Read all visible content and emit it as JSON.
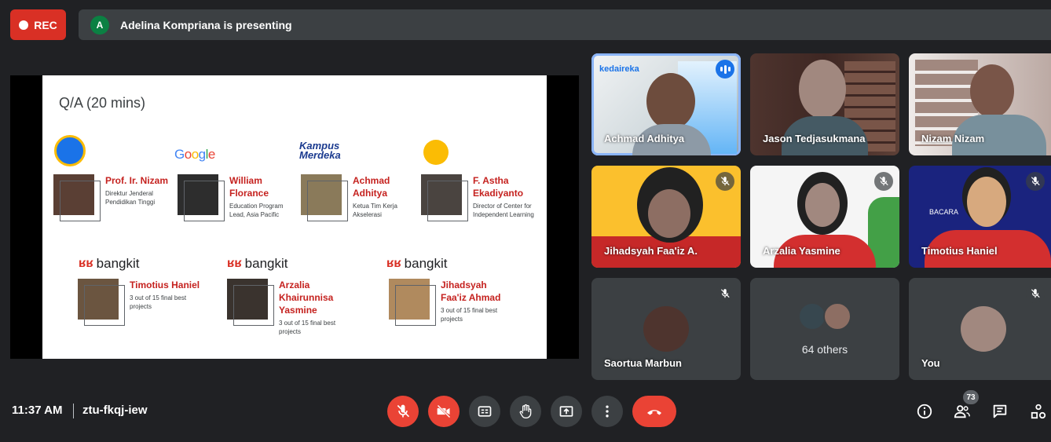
{
  "recording": {
    "label": "REC"
  },
  "presenting": {
    "avatar_initial": "A",
    "text": "Adelina Kompriana is presenting"
  },
  "slide": {
    "title": "Q/A (20 mins)",
    "logos": {
      "google": "Google",
      "kampus_merdeka": "Kampus Merdeka",
      "bangkit": "bangkit"
    },
    "people": [
      {
        "name": "Prof. Ir. Nizam",
        "role": "Direktur Jenderal Pendidikan Tinggi"
      },
      {
        "name": "William Florance",
        "role": "Education Program Lead, Asia Pacific"
      },
      {
        "name": "Achmad Adhitya",
        "role": "Ketua Tim Kerja Akselerasi"
      },
      {
        "name": "F. Astha Ekadiyanto",
        "role": "Director of Center for Independent Learning"
      },
      {
        "name": "Timotius Haniel",
        "role": "3 out of 15 final best projects"
      },
      {
        "name": "Arzalia Khairunnisa Yasmine",
        "role": "3 out of 15 final best projects"
      },
      {
        "name": "Jihadsyah Faa'iz Ahmad",
        "role": "3 out of 15 final best projects"
      }
    ]
  },
  "participants": [
    {
      "name": "Achmad Adhitya",
      "speaking": true,
      "muted": false
    },
    {
      "name": "Jason Tedjasukmana",
      "speaking": false,
      "muted": false
    },
    {
      "name": "Nizam Nizam",
      "speaking": false,
      "muted": false
    },
    {
      "name": "Jihadsyah Faa'iz A.",
      "speaking": false,
      "muted": true
    },
    {
      "name": "Arzalia Yasmine",
      "speaking": false,
      "muted": true
    },
    {
      "name": "Timotius Haniel",
      "speaking": false,
      "muted": true
    },
    {
      "name": "Saortua Marbun",
      "speaking": false,
      "muted": true
    },
    {
      "name": "64 others",
      "speaking": false,
      "muted": false
    },
    {
      "name": "You",
      "speaking": false,
      "muted": true
    }
  ],
  "tile_text": {
    "kedaireka": "kedaireka",
    "bacara": "BACARA"
  },
  "bottom": {
    "time": "11:37 AM",
    "meeting_code": "ztu-fkqj-iew",
    "people_count": "73"
  },
  "colors": {
    "accent_red": "#ea4335",
    "bar_bg": "#202124",
    "speaking_blue": "#1a73e8"
  }
}
